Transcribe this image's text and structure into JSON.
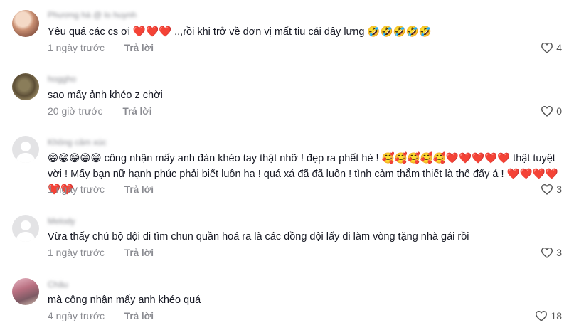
{
  "comments": [
    {
      "username": "Phương hà @ lo huynh",
      "text": "Yêu quá các cs ơi ❤️❤️❤️ ,,,rồi khi trở về đơn vị mất tiu cái dây lưng 🤣🤣🤣🤣🤣",
      "time": "1 ngày trước",
      "reply_label": "Trả lời",
      "likes": "4",
      "avatar": "user-photo"
    },
    {
      "username": "hoggho",
      "text": "sao mấy ảnh khéo z chời",
      "time": "20 giờ trước",
      "reply_label": "Trả lời",
      "likes": "0",
      "avatar": "user-photo"
    },
    {
      "username": "Không cảm xúc",
      "text": "😁😁😁😁😁 công nhận mấy anh đàn khéo tay thật nhỡ ! đẹp ra phết hè ! 🥰🥰🥰🥰🥰❤️❤️❤️❤️❤️ thật tuyệt vời ! Mấy bạn nữ hạnh phúc phải biết luôn ha ! quá xá đã đã luôn ! tình cảm thắm thiết là thế đấy á ! ❤️❤️❤️❤️❤️❤️",
      "time": "1 ngày trước",
      "reply_label": "Trả lời",
      "likes": "3",
      "avatar": "default-avatar"
    },
    {
      "username": "Melody",
      "text": "Vừa thấy chú bộ đội đi tìm chun quần hoá ra là các đồng đội lấy đi làm vòng tặng nhà gái rồi",
      "time": "1 ngày trước",
      "reply_label": "Trả lời",
      "likes": "3",
      "avatar": "default-avatar"
    },
    {
      "username": "Châu",
      "text": "mà công nhận mấy anh khéo quá",
      "time": "4 ngày trước",
      "reply_label": "Trả lời",
      "likes": "18",
      "avatar": "user-photo"
    }
  ],
  "colors": {
    "text": "#161823",
    "muted": "#8a8b91",
    "background": "#ffffff"
  },
  "icons": {
    "like": "heart-outline-icon",
    "default_avatar": "person-silhouette-icon"
  }
}
